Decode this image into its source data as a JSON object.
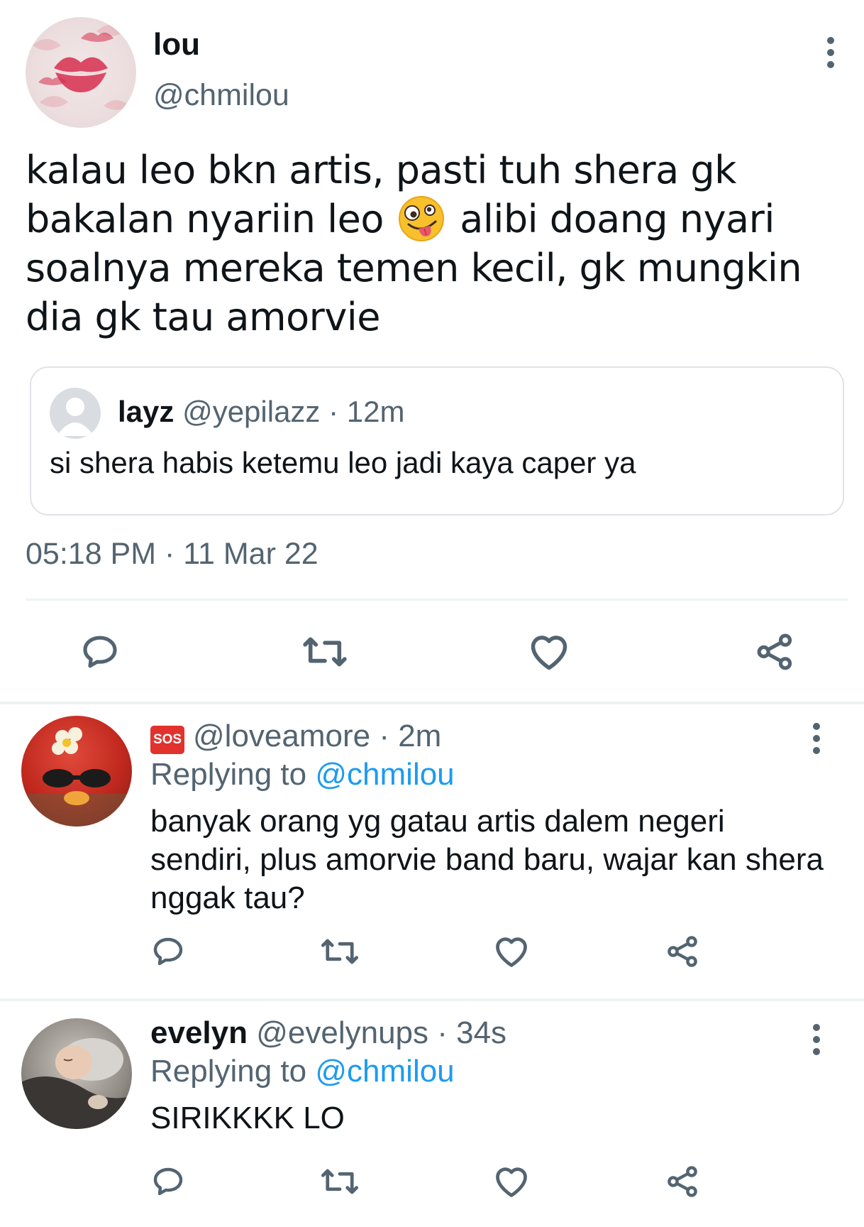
{
  "main_tweet": {
    "author_name": "lou",
    "author_handle": "@chmilou",
    "text_part1": "kalau leo bkn artis, pasti tuh shera gk bakalan nyariin leo",
    "text_part2": "alibi doang nyari soalnya mereka temen kecil, gk mungkin dia gk tau amorvie",
    "emoji_icon": "zany-face-emoji",
    "timestamp": "05:18 PM · 11 Mar 22",
    "quote": {
      "name": "layz",
      "meta": "@yepilazz · 12m",
      "text": "si shera habis ketemu leo jadi kaya caper ya"
    }
  },
  "replies": [
    {
      "badge": "SOS",
      "name": "",
      "meta": "@loveamore · 2m",
      "replying_prefix": "Replying to",
      "replying_handle": "@chmilou",
      "text": "banyak orang yg gatau artis dalem negeri sendiri, plus amorvie band baru, wajar kan shera nggak tau?"
    },
    {
      "name": "evelyn",
      "meta": "@evelynups · 34s",
      "replying_prefix": "Replying to",
      "replying_handle": "@chmilou",
      "text": "SIRIKKKK LO"
    }
  ],
  "colors": {
    "text_primary": "#0f1419",
    "text_secondary": "#536471",
    "link": "#1d9bf0",
    "divider": "#eff3f4"
  }
}
